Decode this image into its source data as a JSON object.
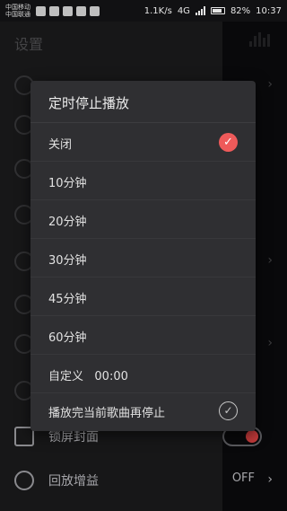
{
  "status_bar": {
    "carrier_1": "中国移动",
    "carrier_2": "中国联通",
    "net_speed": "1.1K/s",
    "network": "4G",
    "battery": "82%",
    "time": "10:37"
  },
  "settings": {
    "title": "设置",
    "rows": [
      {
        "label": "",
        "value": ""
      },
      {
        "label": "",
        "value": ""
      },
      {
        "label": "",
        "value": ""
      },
      {
        "label": "",
        "value": ""
      },
      {
        "label": "",
        "value": ""
      },
      {
        "label": "",
        "value": ""
      },
      {
        "label": "",
        "value": ""
      },
      {
        "label": "",
        "value": ""
      },
      {
        "label": "锁屏封面",
        "value": ""
      },
      {
        "label": "回放增益",
        "value": "OFF"
      }
    ]
  },
  "dialog": {
    "title": "定时停止播放",
    "options": [
      {
        "label": "关闭",
        "selected": true
      },
      {
        "label": "10分钟",
        "selected": false
      },
      {
        "label": "20分钟",
        "selected": false
      },
      {
        "label": "30分钟",
        "selected": false
      },
      {
        "label": "45分钟",
        "selected": false
      },
      {
        "label": "60分钟",
        "selected": false
      },
      {
        "label": "自定义   00:00",
        "selected": false
      }
    ],
    "stop_after_song": {
      "label": "播放完当前歌曲再停止",
      "checked": false
    },
    "check_glyph": "✓"
  },
  "colors": {
    "accent": "#ee5a5a",
    "background": "#2a2a2c",
    "dialog": "#2f2f32"
  }
}
